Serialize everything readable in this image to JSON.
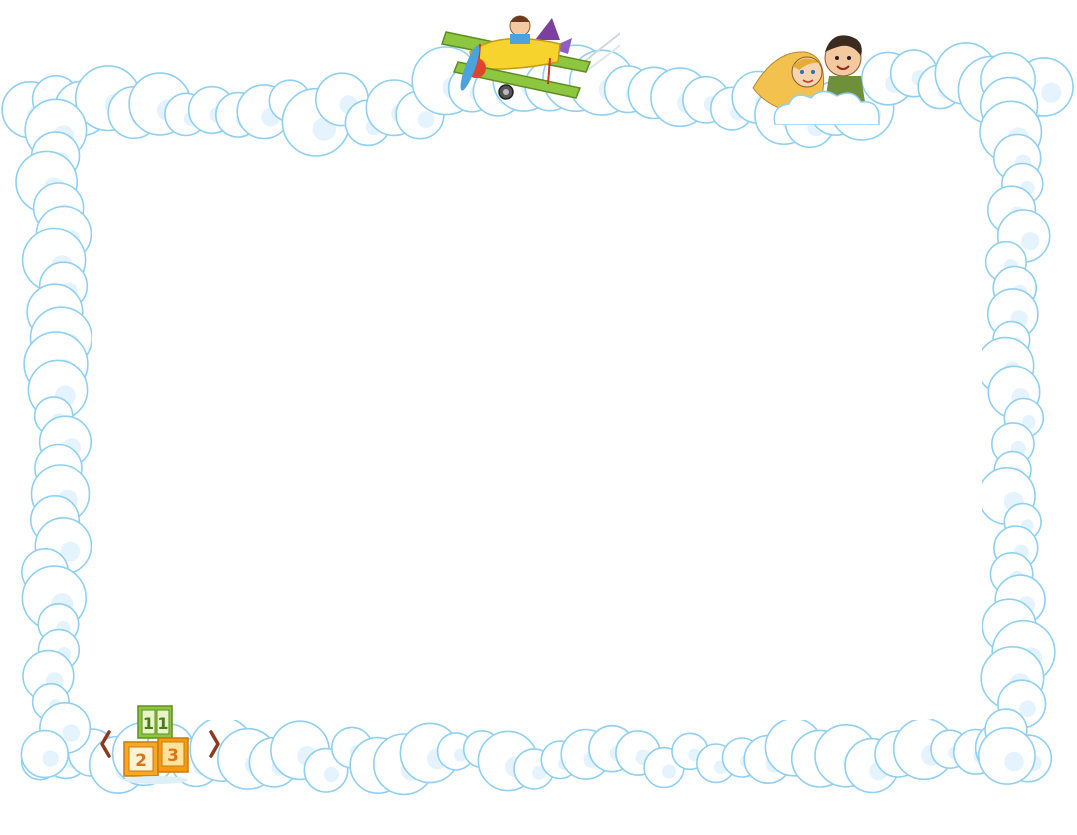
{
  "frame": {
    "background": "#ffffff",
    "cloud_fill": "#ffffff",
    "cloud_outline": "#8fd0f2",
    "cloud_shade": "#cdeafb"
  },
  "decorations": {
    "plane": {
      "icon": "biplane-with-pilot-icon",
      "wing_color": "#8dc63f",
      "body_color": "#f6d32d",
      "propeller_color": "#4aa3df"
    },
    "kids": {
      "icon": "two-kids-on-cloud-icon"
    },
    "blocks": {
      "icon": "number-blocks-icon",
      "labels": [
        "1",
        "1",
        "2",
        "3"
      ],
      "colors": [
        "#8dc63f",
        "#f7a823",
        "#f39c12"
      ]
    }
  },
  "navigation": {
    "prev_icon": "chevron-left-icon",
    "next_icon": "chevron-right-icon",
    "arrow_color": "#8b3a1f"
  }
}
